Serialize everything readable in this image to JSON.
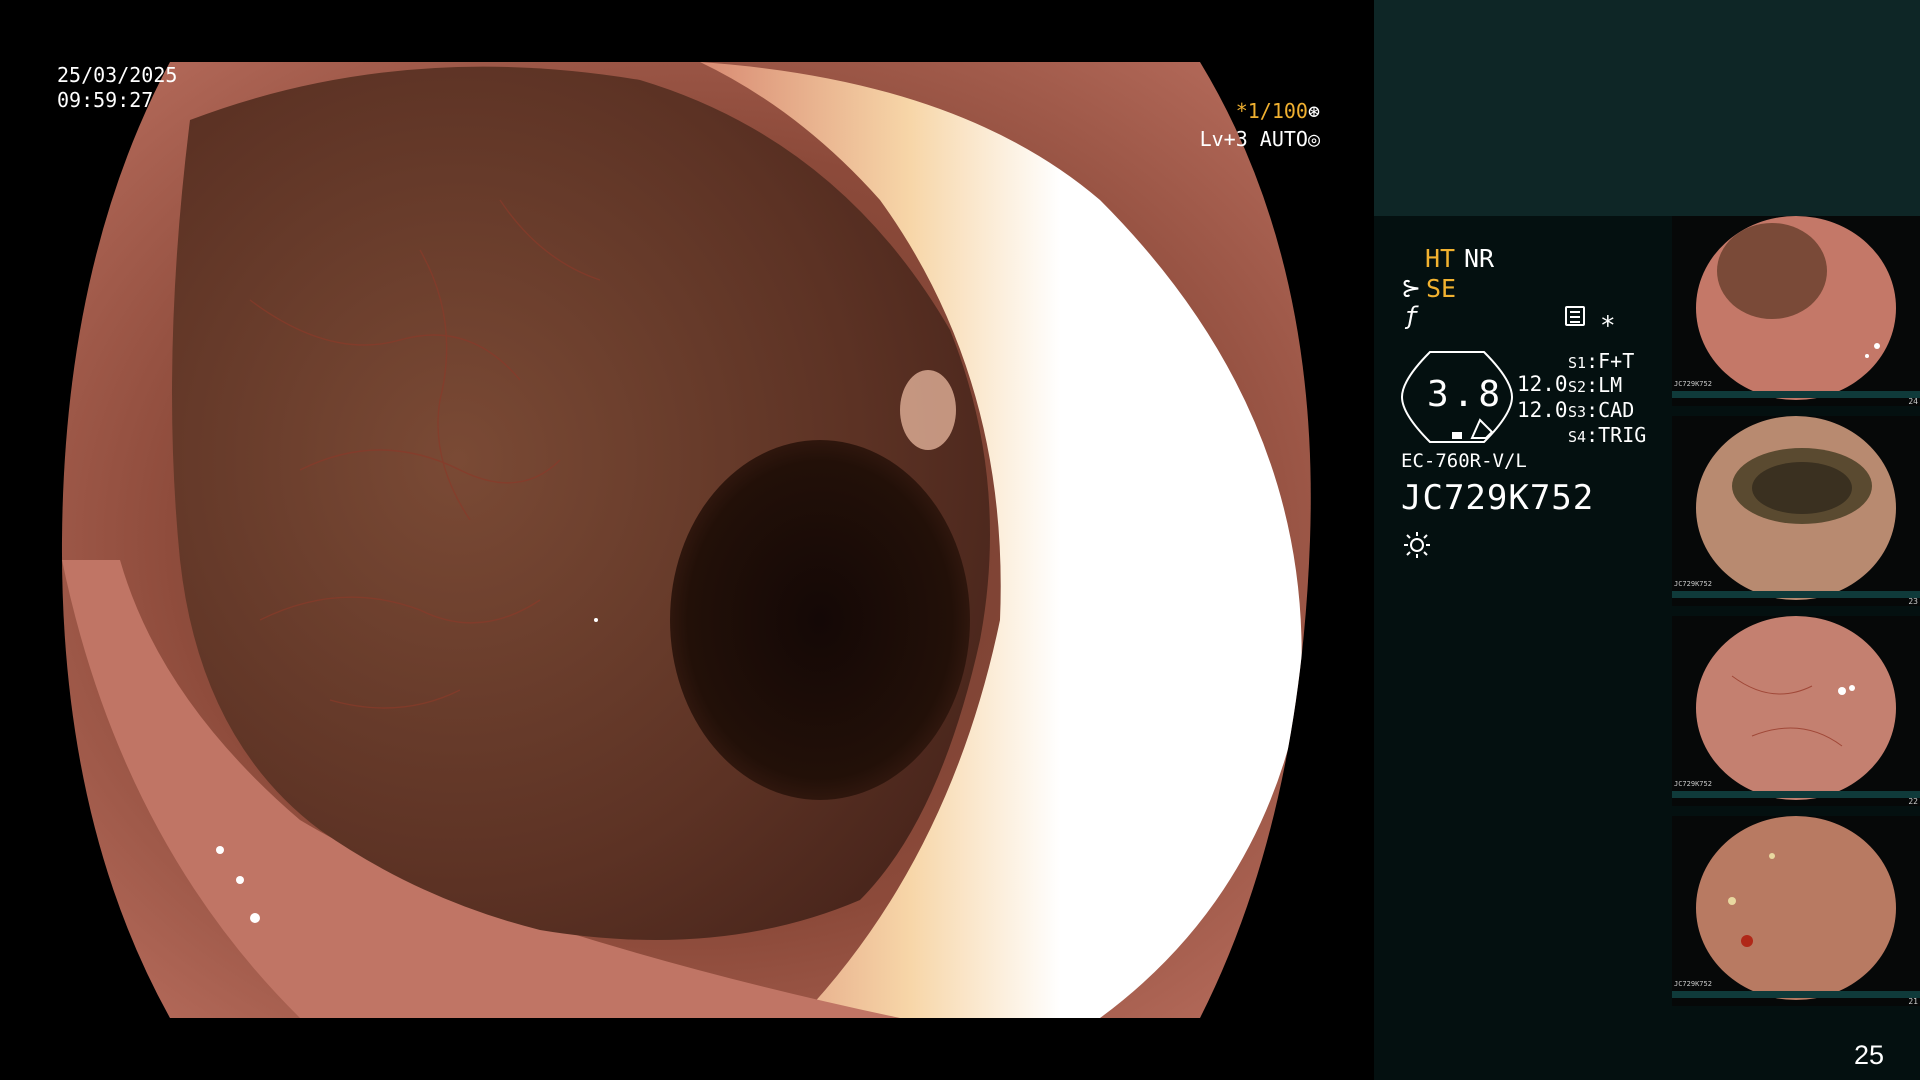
{
  "overlay": {
    "date": "25/03/2025",
    "time": "09:59:27",
    "shutter": "*1/100",
    "level": "Lv+3 AUTO"
  },
  "panel": {
    "ht": "HT",
    "nr": "NR",
    "se": "SE",
    "gauge_value": "3.8",
    "value_a": "12.0",
    "value_b": "12.0",
    "switches": [
      {
        "label": "S1",
        "value": "F+T"
      },
      {
        "label": "S2",
        "value": "LM"
      },
      {
        "label": "S3",
        "value": "CAD"
      },
      {
        "label": "S4",
        "value": "TRIG"
      }
    ],
    "scope_model": "EC-760R-V/L",
    "scope_serial": "JC729K752"
  },
  "thumbnails": [
    {
      "id": "JC729K752",
      "number": "24"
    },
    {
      "id": "JC729K752",
      "number": "23"
    },
    {
      "id": "JC729K752",
      "number": "22"
    },
    {
      "id": "JC729K752",
      "number": "21"
    }
  ],
  "page_number": "25",
  "colors": {
    "accent_orange": "#f2b230",
    "panel_bg": "#041010",
    "panel_top": "#0e2626"
  }
}
